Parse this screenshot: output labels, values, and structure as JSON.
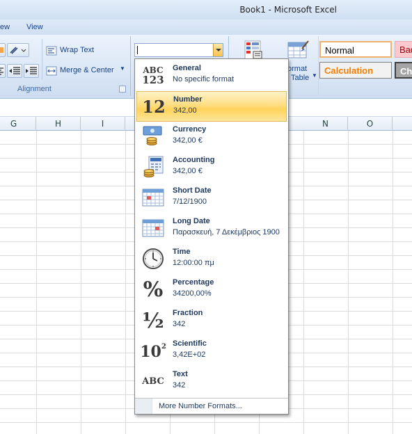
{
  "window": {
    "title": "Book1 - Microsoft Excel"
  },
  "ribbon_tabs": [
    "ew",
    "View"
  ],
  "alignment_group": {
    "wrap_text": "Wrap Text",
    "merge_center": "Merge & Center",
    "title": "Alignment"
  },
  "number_format_combo": {
    "value": ""
  },
  "styles_group": {
    "format_table_line1": "ormat",
    "format_table_line2": "Table",
    "normal": "Normal",
    "bad": "Bad",
    "calculation": "Calculation",
    "check": "Che"
  },
  "columns": [
    "G",
    "H",
    "I",
    "N",
    "O"
  ],
  "format_menu": {
    "items": [
      {
        "icon": "abc-123-icon",
        "name": "General",
        "example": "No specific format"
      },
      {
        "icon": "number-12-icon",
        "name": "Number",
        "example": "342,00",
        "selected": true
      },
      {
        "icon": "currency-icon",
        "name": "Currency",
        "example": "342,00 €"
      },
      {
        "icon": "accounting-icon",
        "name": "Accounting",
        "example": " 342,00 €"
      },
      {
        "icon": "calendar-icon",
        "name": "Short Date",
        "example": "7/12/1900"
      },
      {
        "icon": "calendar-icon",
        "name": "Long Date",
        "example": "Παρασκευή, 7 Δεκέμβριος 1900"
      },
      {
        "icon": "clock-icon",
        "name": "Time",
        "example": "12:00:00 πμ"
      },
      {
        "icon": "percent-icon",
        "name": "Percentage",
        "example": "34200,00%"
      },
      {
        "icon": "fraction-icon",
        "name": "Fraction",
        "example": "342"
      },
      {
        "icon": "scientific-icon",
        "name": "Scientific",
        "example": "3,42E+02"
      },
      {
        "icon": "abc-text-icon",
        "name": "Text",
        "example": "342"
      }
    ],
    "more": "More Number Formats..."
  },
  "colors": {
    "selected_gradient_top": "#fff3c6",
    "selected_gradient_mid": "#ffd45d",
    "calculation_text": "#fa7d00",
    "bad_bg": "#ffc7ce"
  }
}
